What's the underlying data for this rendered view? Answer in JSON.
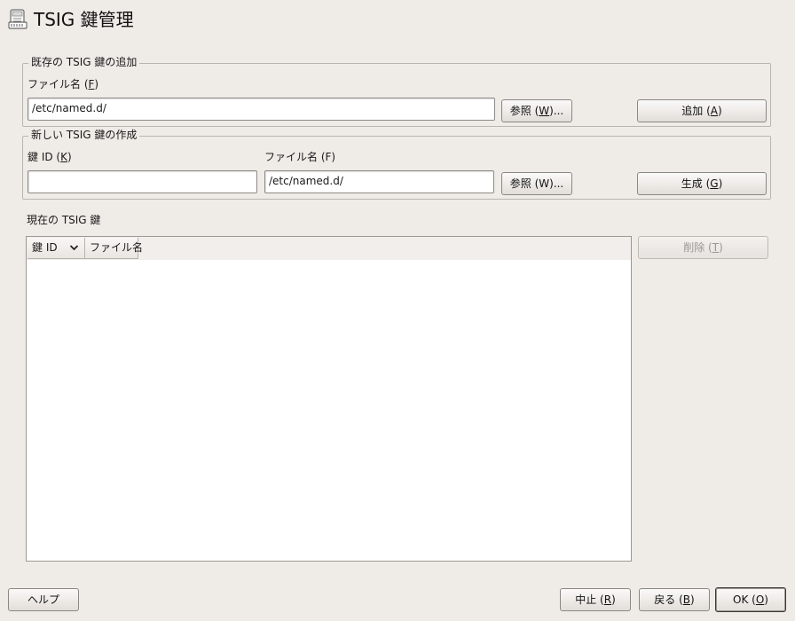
{
  "window": {
    "title": "TSIG 鍵管理",
    "icon": "server-key-icon"
  },
  "add_existing": {
    "legend": "既存の TSIG 鍵の追加",
    "filename_label": "ファイル名 (",
    "filename_mnemonic": "F",
    "filename_label_end": ")",
    "filename_value": "/etc/named.d/",
    "browse_label": "参照 (",
    "browse_mnemonic": "W",
    "browse_label_end": ")...",
    "add_label": "追加 (",
    "add_mnemonic": "A",
    "add_label_end": ")"
  },
  "create_new": {
    "legend": "新しい TSIG 鍵の作成",
    "keyid_label": "鍵 ID (",
    "keyid_mnemonic": "K",
    "keyid_label_end": ")",
    "keyid_value": "",
    "filename_label": "ファイル名 (F)",
    "filename_value": "/etc/named.d/",
    "browse_label": "参照 (W)...",
    "generate_label": "生成 (",
    "generate_mnemonic": "G",
    "generate_label_end": ")"
  },
  "current_keys": {
    "label": "現在の TSIG 鍵",
    "columns": [
      "鍵 ID",
      "ファイル名"
    ],
    "rows": [],
    "delete_label": "削除 (",
    "delete_mnemonic": "T",
    "delete_label_end": ")"
  },
  "footer": {
    "help_label": "ヘルプ",
    "abort_label": "中止 (",
    "abort_mnemonic": "R",
    "abort_label_end": ")",
    "back_label": "戻る (",
    "back_mnemonic": "B",
    "back_label_end": ")",
    "ok_label": "OK (",
    "ok_mnemonic": "O",
    "ok_label_end": ")"
  },
  "colors": {
    "background": "#efebe7",
    "frame_border": "#b9b5b0",
    "disabled_text": "#9a9692"
  }
}
